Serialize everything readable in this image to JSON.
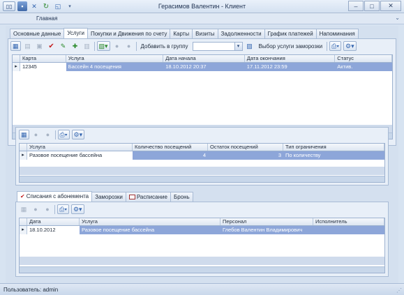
{
  "window": {
    "title": "Герасимов Валентин - Клиент",
    "ribbon_tab": "Главная",
    "status": "Пользователь: admin"
  },
  "main_tabs": [
    "Основные данные",
    "Услуги",
    "Покупки и Движения по счету",
    "Карты",
    "Визиты",
    "Задолженности",
    "График платежей",
    "Напоминания"
  ],
  "main_tabs_active": "Услуги",
  "services_toolbar": {
    "add_group_label": "Добавить в группу",
    "freeze_label": "Выбор услуги заморозки"
  },
  "services_grid": {
    "columns": [
      "Карта",
      "Услуга",
      "Дата начала",
      "Дата окончания",
      "Статус"
    ],
    "rows": [
      [
        "12345",
        "Бассейн 4 посещения",
        "18.10.2012 20:37",
        "17.11.2012 23:59",
        "Актив."
      ]
    ]
  },
  "visits_grid": {
    "columns": [
      "Услуга",
      "Количество посещений",
      "Остаток посещений",
      "Тип ограничения"
    ],
    "rows": [
      [
        "Разовое посещение бассейна",
        "4",
        "3",
        "По количеству"
      ]
    ]
  },
  "sub_tabs": [
    "Списания с абонемента",
    "Заморозки",
    "Расписание",
    "Бронь"
  ],
  "sub_tabs_active": "Списания с абонемента",
  "writeoffs_grid": {
    "columns": [
      "Дата",
      "Услуга",
      "Персонал",
      "Исполнитель"
    ],
    "rows": [
      [
        "18.10.2012",
        "Разовое посещение бассейна",
        "Глебов Валентин Владимирович",
        ""
      ]
    ]
  },
  "colors": {
    "selected_row": "#8da6d9",
    "chrome": "#d7e3f1"
  }
}
